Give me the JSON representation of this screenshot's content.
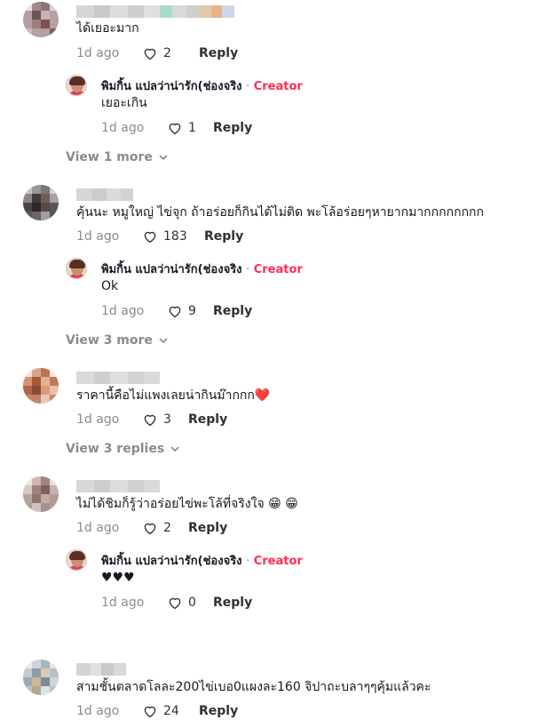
{
  "comments": [
    {
      "text": "ได้เยอะมาก",
      "date": "1d ago",
      "likes": "2",
      "reply_label": "Reply",
      "replies": [
        {
          "author": "พิมกิ้น แปลว่าน่ารัก(ช่องจริง",
          "separator": "·",
          "badge": "Creator",
          "text": "เยอะเกิน",
          "date": "1d ago",
          "likes": "1",
          "reply_label": "Reply"
        }
      ],
      "view_more": "View 1 more"
    },
    {
      "text": "คุ้นนะ หมูใหญ่ ไข่จุก ถ้าอร่อยก็กินได้ไม่ติด พะโล้อร่อยๆหายากมากกกกกกกก",
      "date": "1d ago",
      "likes": "183",
      "reply_label": "Reply",
      "replies": [
        {
          "author": "พิมกิ้น แปลว่าน่ารัก(ช่องจริง",
          "separator": "·",
          "badge": "Creator",
          "text": "Ok",
          "date": "1d ago",
          "likes": "9",
          "reply_label": "Reply"
        }
      ],
      "view_more": "View 3 more"
    },
    {
      "text": "ราคานี้คือไม่แพงเลยน่ากินม๊ากกก",
      "emoji": "❤️",
      "date": "1d ago",
      "likes": "3",
      "reply_label": "Reply",
      "view_more": "View 3 replies"
    },
    {
      "text": "ไม่ได้ชิมก็รู้ว่าอร่อยไข่พะโล้ที่จริงใจ",
      "emoji": "😁 😁",
      "date": "1d ago",
      "likes": "2",
      "reply_label": "Reply",
      "replies": [
        {
          "author": "พิมกิ้น แปลว่าน่ารัก(ช่องจริง",
          "separator": "·",
          "badge": "Creator",
          "text": "♥♥♥",
          "date": "1d ago",
          "likes": "0",
          "reply_label": "Reply"
        }
      ]
    },
    {
      "text": "สามชั้นตลาดโลละ200ไข่เบอ0แผงละ160 จิปาถะบลาๆๆคุ้มแล้วคะ",
      "date": "1d ago",
      "likes": "24",
      "reply_label": "Reply"
    }
  ],
  "colors": {
    "creator": "#fe2c55",
    "muted": "#8a8b91",
    "text": "#161823"
  },
  "icons": {
    "like": "heart-outline-icon",
    "expand": "chevron-down-icon"
  }
}
